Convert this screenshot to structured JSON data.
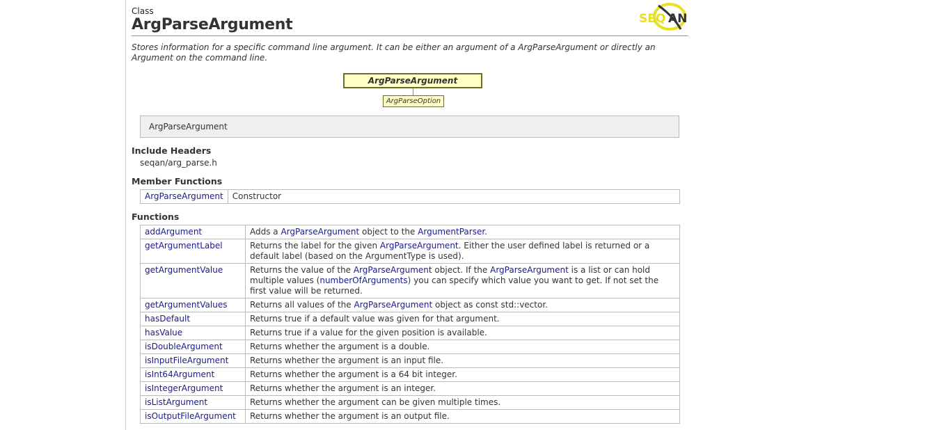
{
  "header": {
    "kind": "Class",
    "title": "ArgParseArgument",
    "logo_text": "SEQAN"
  },
  "summary": "Stores information for a specific command line argument. It can be either an argument of a ArgParseArgument or directly an Argument on the command line.",
  "diagram": {
    "main": "ArgParseArgument",
    "child": "ArgParseOption"
  },
  "signature": "ArgParseArgument",
  "include": {
    "heading": "Include Headers",
    "path": "seqan/arg_parse.h"
  },
  "members": {
    "heading": "Member Functions",
    "rows": [
      {
        "name": "ArgParseArgument",
        "desc": "Constructor"
      }
    ]
  },
  "functions": {
    "heading": "Functions",
    "rows": [
      {
        "name": "addArgument",
        "desc": [
          {
            "t": "Adds a "
          },
          {
            "l": "ArgParseArgument"
          },
          {
            "t": " object to the "
          },
          {
            "l": "ArgumentParser"
          },
          {
            "t": "."
          }
        ]
      },
      {
        "name": "getArgumentLabel",
        "desc": [
          {
            "t": "Returns the label for the given "
          },
          {
            "l": "ArgParseArgument"
          },
          {
            "t": ". Either the user defined label is returned or a default label (based on the ArgumentType is used)."
          }
        ]
      },
      {
        "name": "getArgumentValue",
        "desc": [
          {
            "t": "Returns the value of the "
          },
          {
            "l": "ArgParseArgument"
          },
          {
            "t": " object. If the "
          },
          {
            "l": "ArgParseArgument"
          },
          {
            "t": " is a list or can hold multiple values ("
          },
          {
            "l": "numberOfArguments"
          },
          {
            "t": ") you can specify which value you want to get. If not set the first value will be returned."
          }
        ]
      },
      {
        "name": "getArgumentValues",
        "desc": [
          {
            "t": "Returns all values of the "
          },
          {
            "l": "ArgParseArgument"
          },
          {
            "t": " object as const std::vector."
          }
        ]
      },
      {
        "name": "hasDefault",
        "desc": [
          {
            "t": "Returns true if a default value was given for that argument."
          }
        ]
      },
      {
        "name": "hasValue",
        "desc": [
          {
            "t": "Returns true if a value for the given position is available."
          }
        ]
      },
      {
        "name": "isDoubleArgument",
        "desc": [
          {
            "t": "Returns whether the argument is a double."
          }
        ]
      },
      {
        "name": "isInputFileArgument",
        "desc": [
          {
            "t": "Returns whether the argument is an input file."
          }
        ]
      },
      {
        "name": "isInt64Argument",
        "desc": [
          {
            "t": "Returns whether the argument is a 64 bit integer."
          }
        ]
      },
      {
        "name": "isIntegerArgument",
        "desc": [
          {
            "t": "Returns whether the argument is an integer."
          }
        ]
      },
      {
        "name": "isListArgument",
        "desc": [
          {
            "t": "Returns whether the argument can be given multiple times."
          }
        ]
      },
      {
        "name": "isOutputFileArgument",
        "desc": [
          {
            "t": "Returns whether the argument is an output file."
          }
        ]
      }
    ]
  },
  "colors": {
    "link": "#1a1a8c",
    "diagram_fill": "#ffffc6",
    "logo_yellow": "#e8e020"
  }
}
